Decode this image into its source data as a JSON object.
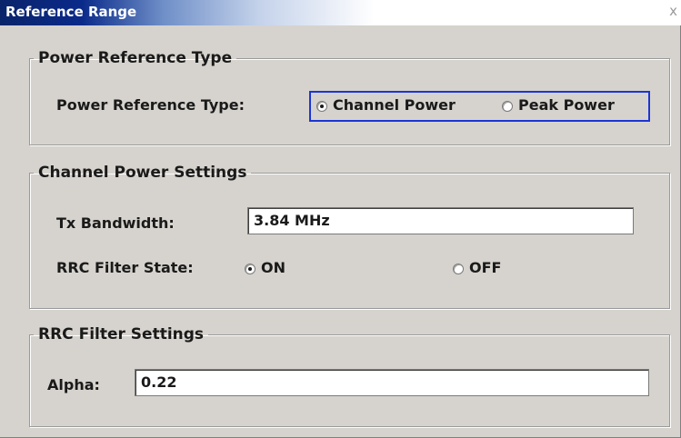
{
  "window": {
    "title": "Reference Range",
    "close_label": "x"
  },
  "power_reference": {
    "group_title": "Power Reference Type",
    "label": "Power Reference Type:",
    "options": [
      {
        "label": "Channel Power",
        "selected": true
      },
      {
        "label": "Peak Power",
        "selected": false
      }
    ]
  },
  "channel_power": {
    "group_title": "Channel Power Settings",
    "tx_bandwidth_label": "Tx Bandwidth:",
    "tx_bandwidth_value": "3.84 MHz",
    "rrc_filter_label": "RRC Filter State:",
    "rrc_options": [
      {
        "label": "ON",
        "selected": true
      },
      {
        "label": "OFF",
        "selected": false
      }
    ]
  },
  "rrc_filter": {
    "group_title": "RRC Filter Settings",
    "alpha_label": "Alpha:",
    "alpha_value": "0.22"
  }
}
